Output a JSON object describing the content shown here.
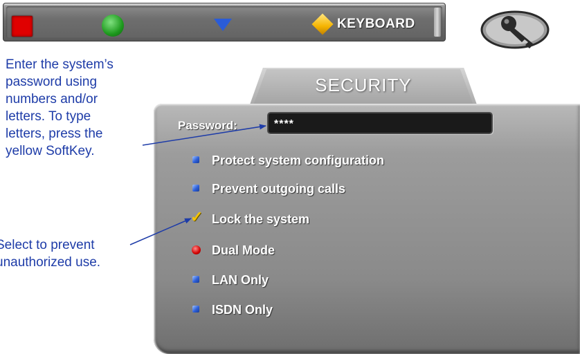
{
  "softkeys": {
    "yellow_label": "KEYBOARD",
    "red_icon": "red-square-icon",
    "green_icon": "green-circle-icon",
    "blue_icon": "blue-triangle-icon",
    "yellow_icon": "yellow-diamond-icon",
    "colors": {
      "red": "#e00000",
      "green": "#1e9a1e",
      "blue": "#2a5cd8",
      "yellow": "#f5b400"
    }
  },
  "key_icon": "key-icon",
  "annotations": {
    "password_help": [
      "Enter the system’s",
      "password using",
      "numbers and/or",
      "letters. To type",
      "letters, press the",
      "yellow SoftKey."
    ],
    "lock_help": [
      "Select to prevent",
      "unauthorized use."
    ]
  },
  "panel": {
    "title": "SECURITY",
    "password_label": "Password:",
    "password_value": "****",
    "options": [
      {
        "label": "Protect system configuration",
        "control": "checkbox",
        "checked": false
      },
      {
        "label": "Prevent outgoing calls",
        "control": "checkbox",
        "checked": false
      },
      {
        "label": "Lock the system",
        "control": "checkbox",
        "checked": true
      },
      {
        "label": "Dual Mode",
        "control": "radio",
        "selected": true
      },
      {
        "label": "LAN Only",
        "control": "radio",
        "selected": false
      },
      {
        "label": "ISDN Only",
        "control": "radio",
        "selected": false
      }
    ]
  }
}
